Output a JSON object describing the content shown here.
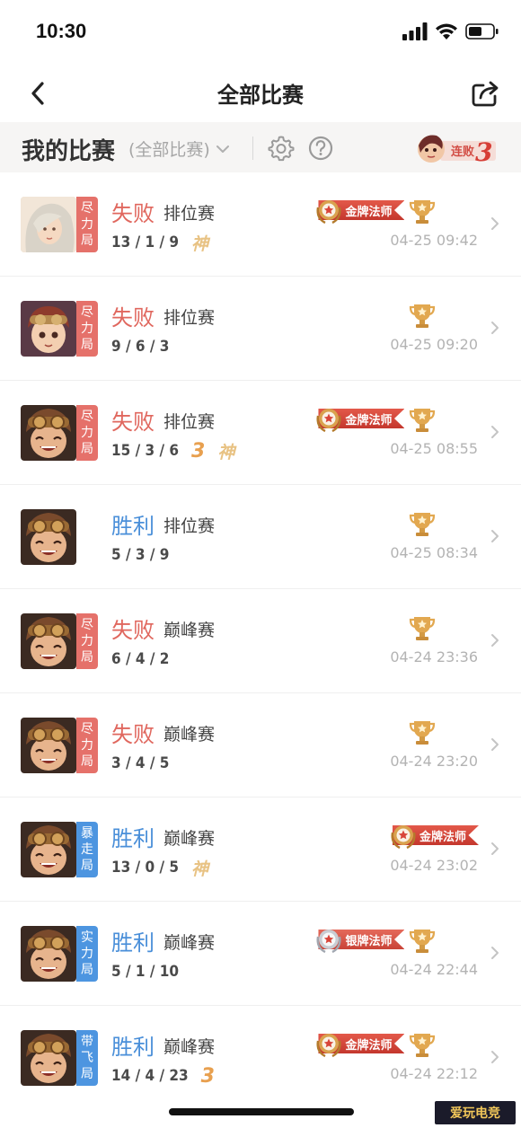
{
  "status_bar": {
    "time": "10:30"
  },
  "nav": {
    "title": "全部比赛"
  },
  "filter": {
    "section_title": "我的比赛",
    "dropdown_label": "(全部比赛)",
    "streak_label": "连败",
    "streak_count": "3"
  },
  "badge_labels": {
    "gold_mage": "金牌法师",
    "silver_mage": "银牌法师",
    "mvp": "MVP"
  },
  "matches": [
    {
      "tag": "尽力局",
      "tag_color": "red",
      "result": "失败",
      "outcome": "lose",
      "mode": "排位赛",
      "kda": "13 / 1 / 9",
      "god": "神",
      "three": "",
      "badges": [
        "gold_mage",
        "mvp"
      ],
      "time": "04-25 09:42",
      "hero": "female-silver"
    },
    {
      "tag": "尽力局",
      "tag_color": "red",
      "result": "失败",
      "outcome": "lose",
      "mode": "排位赛",
      "kda": "9 / 6 / 3",
      "god": "",
      "three": "",
      "badges": [
        "mvp"
      ],
      "time": "04-25 09:20",
      "hero": "goggle-girl"
    },
    {
      "tag": "尽力局",
      "tag_color": "red",
      "result": "失败",
      "outcome": "lose",
      "mode": "排位赛",
      "kda": "15 / 3 / 6",
      "god": "神",
      "three": "3",
      "badges": [
        "gold_mage",
        "mvp"
      ],
      "time": "04-25 08:55",
      "hero": "goggle-boy"
    },
    {
      "tag": "",
      "tag_color": "",
      "result": "胜利",
      "outcome": "win",
      "mode": "排位赛",
      "kda": "5 / 3 / 9",
      "god": "",
      "three": "",
      "badges": [
        "mvp"
      ],
      "time": "04-25 08:34",
      "hero": "goggle-boy"
    },
    {
      "tag": "尽力局",
      "tag_color": "red",
      "result": "失败",
      "outcome": "lose",
      "mode": "巅峰赛",
      "kda": "6 / 4 / 2",
      "god": "",
      "three": "",
      "badges": [
        "mvp"
      ],
      "time": "04-24 23:36",
      "hero": "goggle-boy"
    },
    {
      "tag": "尽力局",
      "tag_color": "red",
      "result": "失败",
      "outcome": "lose",
      "mode": "巅峰赛",
      "kda": "3 / 4 / 5",
      "god": "",
      "three": "",
      "badges": [
        "mvp"
      ],
      "time": "04-24 23:20",
      "hero": "goggle-boy"
    },
    {
      "tag": "暴走局",
      "tag_color": "blue",
      "result": "胜利",
      "outcome": "win",
      "mode": "巅峰赛",
      "kda": "13 / 0 / 5",
      "god": "神",
      "three": "",
      "badges": [
        "gold_mage"
      ],
      "time": "04-24 23:02",
      "hero": "goggle-boy"
    },
    {
      "tag": "实力局",
      "tag_color": "blue",
      "result": "胜利",
      "outcome": "win",
      "mode": "巅峰赛",
      "kda": "5 / 1 / 10",
      "god": "",
      "three": "",
      "badges": [
        "silver_mage",
        "mvp"
      ],
      "time": "04-24 22:44",
      "hero": "goggle-boy"
    },
    {
      "tag": "带飞局",
      "tag_color": "blue",
      "result": "胜利",
      "outcome": "win",
      "mode": "巅峰赛",
      "kda": "14 / 4 / 23",
      "god": "",
      "three": "3",
      "badges": [
        "gold_mage",
        "mvp"
      ],
      "time": "04-24 22:12",
      "hero": "goggle-boy"
    }
  ],
  "watermark": "爱玩电竞"
}
